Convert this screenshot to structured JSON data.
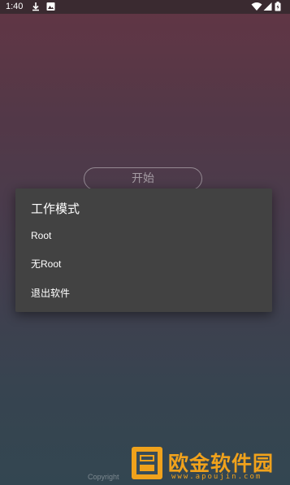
{
  "status_bar": {
    "time": "1:40",
    "icons": [
      "download-icon",
      "image-notification-icon",
      "wifi-icon",
      "signal-icon",
      "battery-icon"
    ]
  },
  "main": {
    "start_button_label": "开始"
  },
  "dialog": {
    "title": "工作模式",
    "items": [
      {
        "label": "Root"
      },
      {
        "label": "无Root"
      },
      {
        "label": "退出软件"
      }
    ]
  },
  "footer": {
    "copyright": "Copyright"
  },
  "watermark": {
    "brand": "欧金软件园",
    "url": "www.apoujin.com"
  },
  "colors": {
    "dialog_bg": "#424242",
    "status_bar_bg": "#3a2a30",
    "watermark_accent": "#f0a21c"
  }
}
